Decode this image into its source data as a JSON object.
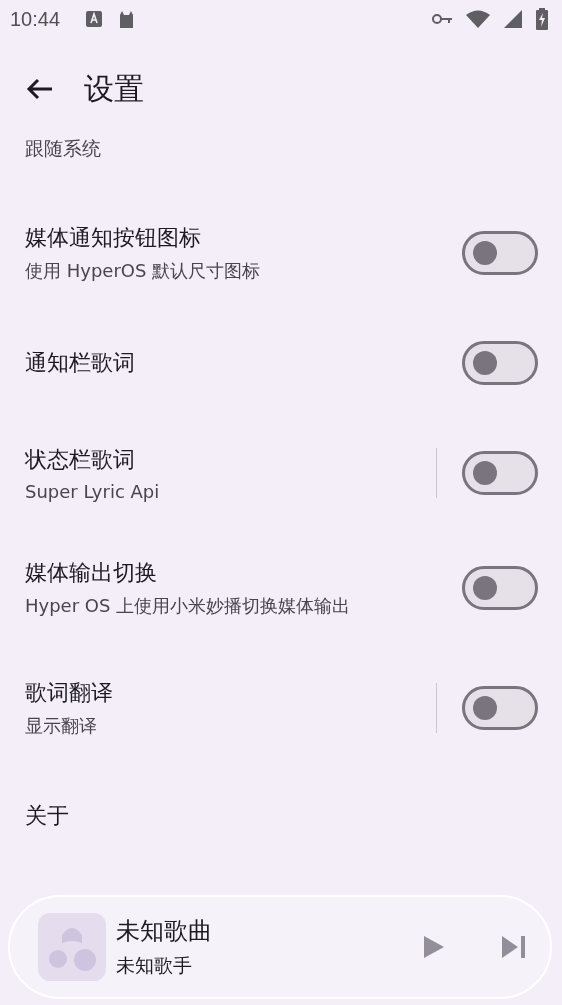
{
  "status_bar": {
    "time": "10:44"
  },
  "top_bar": {
    "title": "设置"
  },
  "partial_subtitle": "跟随系统",
  "settings": [
    {
      "kind": "switch",
      "title": "媒体通知按钮图标",
      "subtitle": "使用 HyperOS 默认尺寸图标",
      "on": false,
      "divider": false
    },
    {
      "kind": "switch",
      "title": "通知栏歌词",
      "on": false,
      "divider": false
    },
    {
      "kind": "switch",
      "title": "状态栏歌词",
      "subtitle": "Super Lyric Api",
      "on": false,
      "divider": true
    },
    {
      "kind": "switch",
      "title": "媒体输出切换",
      "subtitle": "Hyper OS 上使用小米妙播切换媒体输出",
      "on": false,
      "divider": false
    },
    {
      "kind": "switch",
      "title": "歌词翻译",
      "subtitle": "显示翻译",
      "on": false,
      "divider": true
    },
    {
      "kind": "link",
      "title": "关于"
    }
  ],
  "player": {
    "song": "未知歌曲",
    "artist": "未知歌手"
  }
}
